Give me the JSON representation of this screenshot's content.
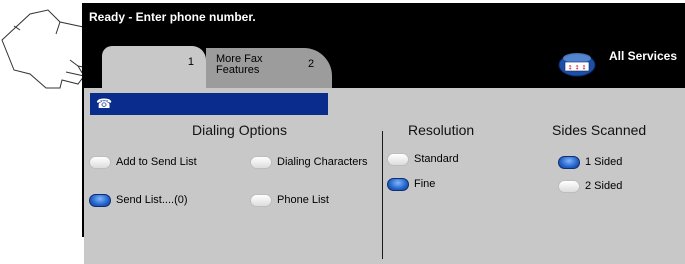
{
  "status_message": "Ready - Enter phone number.",
  "tabs": [
    {
      "number": "1",
      "label": ""
    },
    {
      "label_line1": "More Fax",
      "label_line2": "Features",
      "number": "2"
    }
  ],
  "all_services": {
    "label": "All Services",
    "icon": "all-services-icon"
  },
  "phone_field": {
    "value": "",
    "icon": "telephone-icon"
  },
  "dialing_options": {
    "heading": "Dialing Options",
    "items": [
      {
        "label": "Add to Send List",
        "selected": false
      },
      {
        "label": "Dialing Characters",
        "selected": false
      },
      {
        "label": "Send List....(0)",
        "selected": true
      },
      {
        "label": "Phone List",
        "selected": false
      }
    ]
  },
  "resolution": {
    "heading": "Resolution",
    "items": [
      {
        "label": "Standard",
        "selected": false
      },
      {
        "label": "Fine",
        "selected": true
      }
    ]
  },
  "sides_scanned": {
    "heading": "Sides Scanned",
    "items": [
      {
        "label": "1 Sided",
        "selected": true
      },
      {
        "label": "2 Sided",
        "selected": false
      }
    ]
  },
  "colors": {
    "screen": "#000000",
    "panel": "#c8c8c8",
    "field": "#0a2c8c",
    "selected_radio": "#2463c9"
  }
}
